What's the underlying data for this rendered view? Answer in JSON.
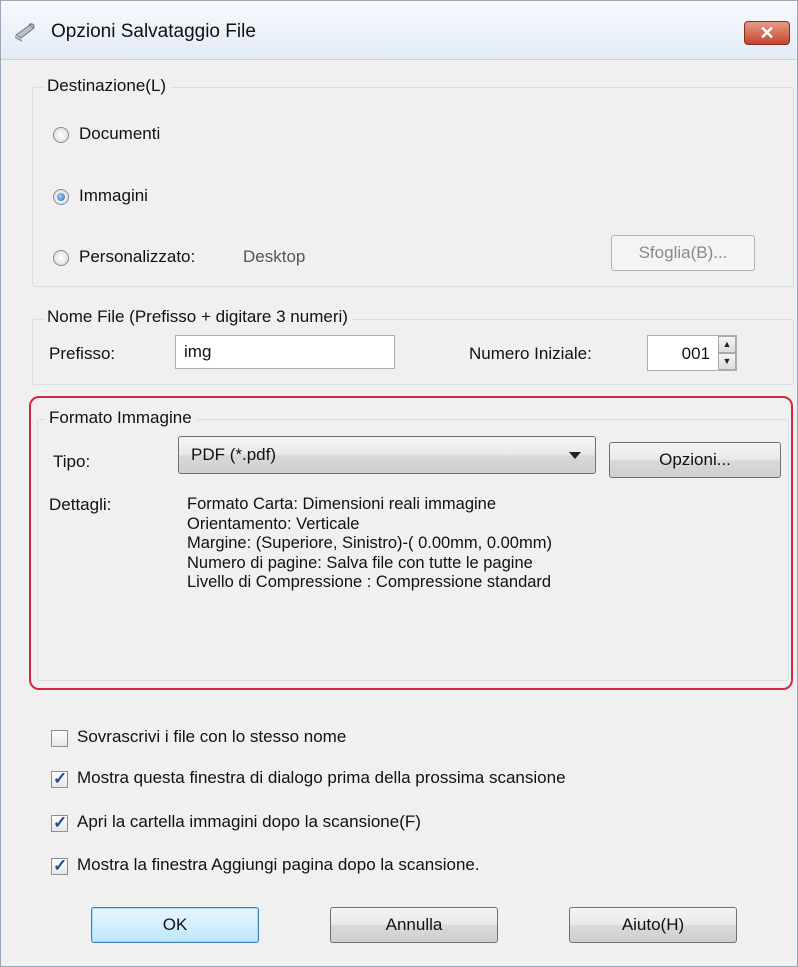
{
  "window": {
    "title": "Opzioni Salvataggio File",
    "close_label": "✕",
    "accent_color": "#d12a3c"
  },
  "destination": {
    "legend": "Destinazione(L)",
    "options": [
      {
        "label": "Documenti",
        "checked": false
      },
      {
        "label": "Immagini",
        "checked": true
      },
      {
        "label": "Personalizzato:",
        "checked": false
      }
    ],
    "custom_path": "Desktop",
    "browse_label": "Sfoglia(B)..."
  },
  "filename": {
    "legend": "Nome File (Prefisso + digitare 3 numeri)",
    "prefix_label": "Prefisso:",
    "prefix_value": "img",
    "start_label": "Numero Iniziale:",
    "start_value": "001"
  },
  "image_format": {
    "legend": "Formato Immagine",
    "type_label": "Tipo:",
    "type_value": "PDF (*.pdf)",
    "options_label": "Opzioni...",
    "details_label": "Dettagli:",
    "details": [
      "Formato Carta: Dimensioni reali immagine",
      "Orientamento: Verticale",
      "Margine: (Superiore, Sinistro)-( 0.00mm, 0.00mm)",
      "Numero di pagine: Salva file con tutte le pagine",
      "Livello di Compressione : Compressione standard"
    ]
  },
  "checkboxes": [
    {
      "label": "Sovrascrivi i file con lo stesso nome",
      "checked": false
    },
    {
      "label": "Mostra questa finestra di dialogo prima della prossima scansione",
      "checked": true
    },
    {
      "label": "Apri la cartella immagini dopo la scansione(F)",
      "checked": true
    },
    {
      "label": "Mostra la finestra Aggiungi pagina dopo la scansione.",
      "checked": true
    }
  ],
  "buttons": {
    "ok": "OK",
    "cancel": "Annulla",
    "help": "Aiuto(H)"
  },
  "icons": {
    "app": "scanner-icon",
    "close": "close-icon",
    "spin_up": "arrow-up-icon",
    "spin_down": "arrow-down-icon",
    "dropdown": "chevron-down-icon",
    "check": "checkmark-icon"
  }
}
